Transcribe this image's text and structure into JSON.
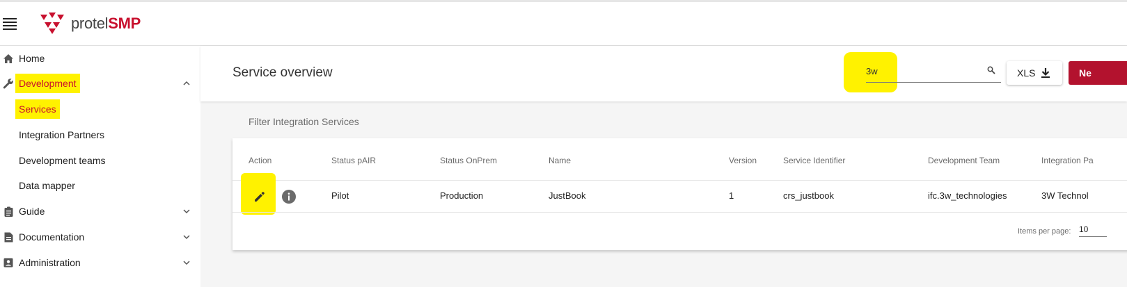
{
  "brand": {
    "name_part1": "protel",
    "name_part2": "SMP",
    "color": "#c8102e"
  },
  "highlight_color": "#fff200",
  "sidebar": {
    "items": [
      {
        "label": "Home",
        "icon": "home-icon"
      },
      {
        "label": "Development",
        "icon": "wrench-icon",
        "expanded": true,
        "highlighted": true
      },
      {
        "label": "Services",
        "sub": true,
        "highlighted": true,
        "selected": true
      },
      {
        "label": "Integration Partners",
        "sub": true
      },
      {
        "label": "Development teams",
        "sub": true
      },
      {
        "label": "Data mapper",
        "sub": true
      },
      {
        "label": "Guide",
        "icon": "clipboard-icon",
        "expanded": false
      },
      {
        "label": "Documentation",
        "icon": "document-icon",
        "expanded": false
      },
      {
        "label": "Administration",
        "icon": "id-card-icon",
        "expanded": false
      }
    ]
  },
  "header": {
    "title": "Service overview",
    "search": {
      "value": "3w"
    },
    "export_label": "XLS",
    "new_label": "Ne"
  },
  "filter_label": "Filter Integration Services",
  "table": {
    "columns": [
      "Action",
      "Status pAIR",
      "Status OnPrem",
      "Name",
      "Version",
      "Service Identifier",
      "Development Team",
      "Integration Pa"
    ],
    "rows": [
      {
        "status_pair": "Pilot",
        "status_onprem": "Production",
        "name": "JustBook",
        "version": "1",
        "service_identifier": "crs_justbook",
        "development_team": "ifc.3w_technologies",
        "integration_partner": "3W Technol"
      }
    ]
  },
  "paginator": {
    "label": "Items per page:",
    "value": "10"
  },
  "colors": {
    "accent": "#b3122e",
    "content_bg": "#f5f5f5"
  }
}
